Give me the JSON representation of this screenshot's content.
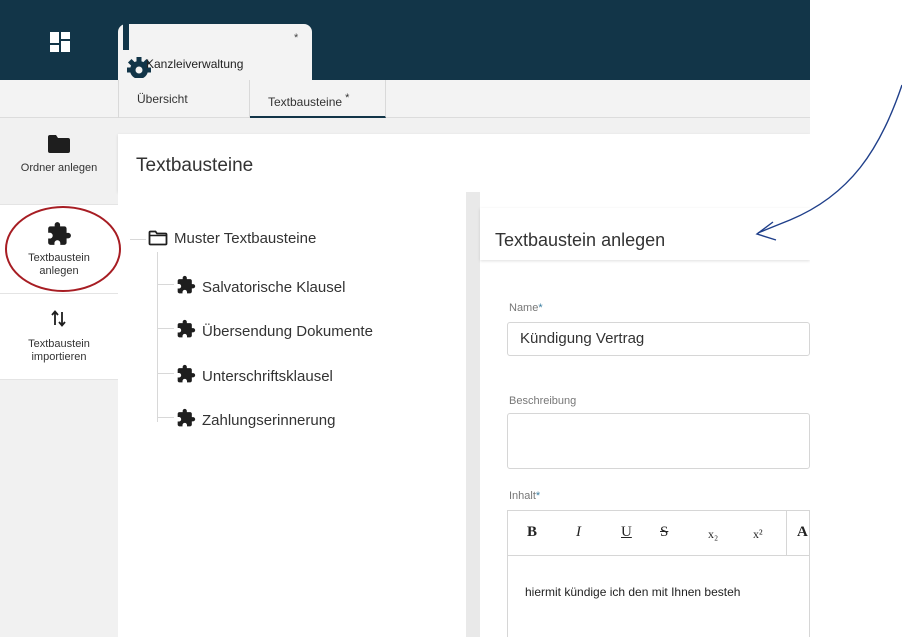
{
  "header": {
    "app_tab_title": "Kanzleiverwaltung",
    "app_tab_marker": "*"
  },
  "tabs": [
    {
      "label": "Übersicht"
    },
    {
      "label": "Textbausteine",
      "marker": "*"
    }
  ],
  "toolbar": {
    "ordner_label": "Ordner anlegen",
    "textbaustein_label_1": "Textbaustein",
    "textbaustein_label_2": "anlegen",
    "import_label_1": "Textbaustein",
    "import_label_2": "importieren"
  },
  "page": {
    "title": "Textbausteine"
  },
  "tree": {
    "root": "Muster Textbausteine",
    "items": [
      "Salvatorische Klausel",
      "Übersendung Dokumente",
      "Unterschriftsklausel",
      "Zahlungserinnerung"
    ]
  },
  "form": {
    "title": "Textbaustein anlegen",
    "name_label": "Name",
    "name_value": "Kündigung Vertrag",
    "beschreibung_label": "Beschreibung",
    "beschreibung_value": "",
    "inhalt_label": "Inhalt",
    "required_marker": "*",
    "inhalt_text": "hiermit kündige ich den mit Ihnen besteh",
    "editor_buttons": [
      "B",
      "I",
      "U",
      "S",
      "x₂",
      "x²",
      "A"
    ]
  },
  "colors": {
    "header": "#123548",
    "highlight_ring": "#a71d23",
    "annotation_arrow": "#1f3f8a"
  }
}
